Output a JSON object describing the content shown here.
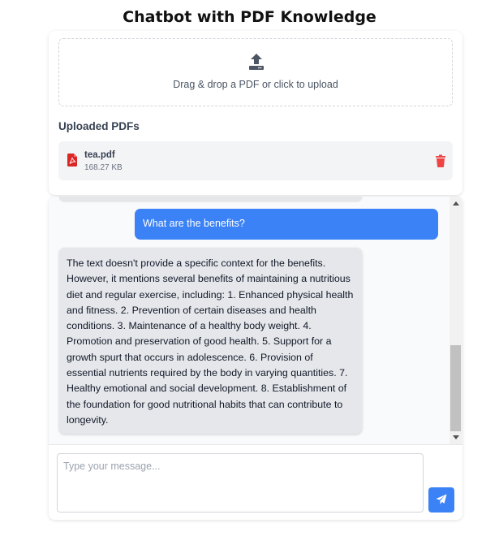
{
  "header": {
    "title": "Chatbot with PDF Knowledge"
  },
  "upload": {
    "dropzone_text": "Drag & drop a PDF or click to upload",
    "section_title": "Uploaded PDFs",
    "files": [
      {
        "name": "tea.pdf",
        "size": "168.27 KB"
      }
    ]
  },
  "chat": {
    "messages": [
      {
        "role": "user",
        "text": "What are the benefits?"
      },
      {
        "role": "bot",
        "text": "The text doesn't provide a specific context for the benefits. However, it mentions several benefits of maintaining a nutritious diet and regular exercise, including: 1. Enhanced physical health and fitness. 2. Prevention of certain diseases and health conditions. 3. Maintenance of a healthy body weight. 4. Promotion and preservation of good health. 5. Support for a growth spurt that occurs in adolescence. 6. Provision of essential nutrients required by the body in varying quantities. 7. Healthy emotional and social development. 8. Establishment of the foundation for good nutritional habits that can contribute to longevity."
      }
    ],
    "input": {
      "placeholder": "Type your message...",
      "value": ""
    }
  },
  "icons": {
    "upload": "upload-icon",
    "pdf": "file-pdf-icon",
    "delete": "trash-icon",
    "send": "paper-plane-icon"
  },
  "colors": {
    "accent": "#3b82f6",
    "delete": "#ef4444",
    "pdf": "#dc2626",
    "bot_bubble": "#e5e7eb"
  }
}
